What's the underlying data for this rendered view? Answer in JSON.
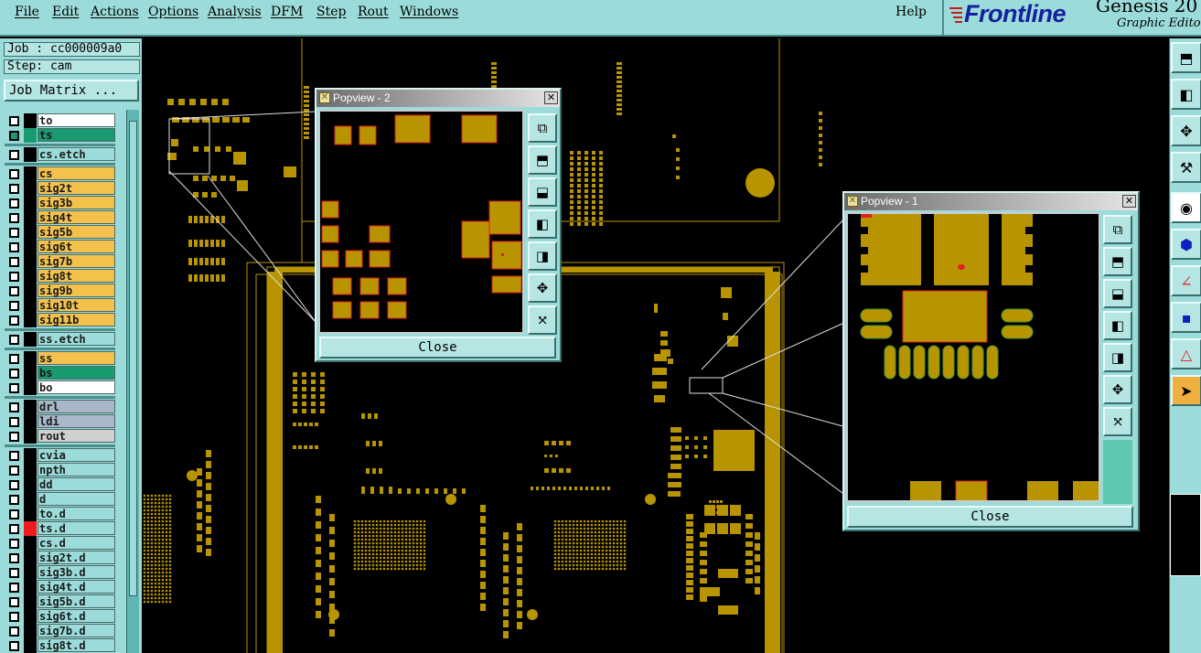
{
  "menu": [
    "File",
    "Edit",
    "Actions",
    "Options",
    "Analysis",
    "DFM",
    "Step",
    "Rout",
    "Windows"
  ],
  "help": "Help",
  "logo": {
    "brand": "Frontline",
    "product": "Genesis 20",
    "subtitle": "Graphic Editor"
  },
  "job": "Job : cc000009a0",
  "step": "Step: cam",
  "job_matrix": "Job Matrix ...",
  "layers": [
    {
      "name": "to",
      "color": "#ffffff",
      "swatch": "#000000",
      "checked": false
    },
    {
      "name": "ts",
      "color": "#1a9a70",
      "swatch": "#1a9a70",
      "checked": true
    },
    {
      "sep": true
    },
    {
      "name": "cs.etch",
      "color": "#9bdcda",
      "swatch": "#000000",
      "checked": false
    },
    {
      "sep": true
    },
    {
      "name": "cs",
      "color": "#f4c24c",
      "swatch": "#000000",
      "checked": false
    },
    {
      "name": "sig2t",
      "color": "#f4c24c",
      "swatch": "#000000",
      "checked": false
    },
    {
      "name": "sig3b",
      "color": "#f4c24c",
      "swatch": "#000000",
      "checked": false
    },
    {
      "name": "sig4t",
      "color": "#f4c24c",
      "swatch": "#000000",
      "checked": false
    },
    {
      "name": "sig5b",
      "color": "#f4c24c",
      "swatch": "#000000",
      "checked": false
    },
    {
      "name": "sig6t",
      "color": "#f4c24c",
      "swatch": "#000000",
      "checked": false
    },
    {
      "name": "sig7b",
      "color": "#f4c24c",
      "swatch": "#000000",
      "checked": false
    },
    {
      "name": "sig8t",
      "color": "#f4c24c",
      "swatch": "#000000",
      "checked": false
    },
    {
      "name": "sig9b",
      "color": "#f4c24c",
      "swatch": "#000000",
      "checked": false
    },
    {
      "name": "sig10t",
      "color": "#f4c24c",
      "swatch": "#000000",
      "checked": false
    },
    {
      "name": "sig11b",
      "color": "#f4c24c",
      "swatch": "#000000",
      "checked": false
    },
    {
      "sep": true
    },
    {
      "name": "ss.etch",
      "color": "#9bdcda",
      "swatch": "#000000",
      "checked": false
    },
    {
      "sep": true
    },
    {
      "name": "ss",
      "color": "#f4c24c",
      "swatch": "#000000",
      "checked": false
    },
    {
      "name": "bs",
      "color": "#1a9a70",
      "swatch": "#000000",
      "checked": false
    },
    {
      "name": "bo",
      "color": "#ffffff",
      "swatch": "#000000",
      "checked": false
    },
    {
      "sep": true
    },
    {
      "name": "drl",
      "color": "#a8b8c8",
      "swatch": "#000000",
      "checked": false
    },
    {
      "name": "ldi",
      "color": "#a8b8c8",
      "swatch": "#000000",
      "checked": false
    },
    {
      "name": "rout",
      "color": "#d0d0d0",
      "swatch": "#000000",
      "checked": false
    },
    {
      "sep": true
    },
    {
      "name": "cvia",
      "color": "#9bdcda",
      "swatch": "#000000",
      "checked": false
    },
    {
      "name": "npth",
      "color": "#9bdcda",
      "swatch": "#000000",
      "checked": false
    },
    {
      "name": "dd",
      "color": "#9bdcda",
      "swatch": "#000000",
      "checked": false
    },
    {
      "name": "d",
      "color": "#9bdcda",
      "swatch": "#000000",
      "checked": false
    },
    {
      "name": "to.d",
      "color": "#9bdcda",
      "swatch": "#000000",
      "checked": false
    },
    {
      "name": "ts.d",
      "color": "#9bdcda",
      "swatch": "#ee1c1c",
      "checked": false
    },
    {
      "name": "cs.d",
      "color": "#9bdcda",
      "swatch": "#000000",
      "checked": false
    },
    {
      "name": "sig2t.d",
      "color": "#9bdcda",
      "swatch": "#000000",
      "checked": false
    },
    {
      "name": "sig3b.d",
      "color": "#9bdcda",
      "swatch": "#000000",
      "checked": false
    },
    {
      "name": "sig4t.d",
      "color": "#9bdcda",
      "swatch": "#000000",
      "checked": false
    },
    {
      "name": "sig5b.d",
      "color": "#9bdcda",
      "swatch": "#000000",
      "checked": false
    },
    {
      "name": "sig6t.d",
      "color": "#9bdcda",
      "swatch": "#000000",
      "checked": false
    },
    {
      "name": "sig7b.d",
      "color": "#9bdcda",
      "swatch": "#000000",
      "checked": false
    },
    {
      "name": "sig8t.d",
      "color": "#9bdcda",
      "swatch": "#000000",
      "checked": false
    }
  ],
  "popview2": {
    "title": "Popview - 2",
    "close": "Close"
  },
  "popview1": {
    "title": "Popview - 1",
    "close": "Close"
  },
  "colors": {
    "panel": "#9bdcda",
    "copper": "#b79400",
    "pad_outline": "#e02020",
    "canvas": "#000000"
  },
  "popup_tools": [
    "zoom-window-icon",
    "zoom-in-icon",
    "zoom-out-icon",
    "pan-left-icon",
    "pan-right-icon",
    "zoom-fit-icon",
    "zoom-extents-icon"
  ],
  "right_tools": [
    "zoom-in-icon",
    "zoom-out-icon",
    "zoom-fit-icon",
    "tools-icon",
    "measure-icon",
    "netlist-icon",
    "angle-icon",
    "features-icon",
    "snap-icon",
    "select-pointer-icon"
  ]
}
